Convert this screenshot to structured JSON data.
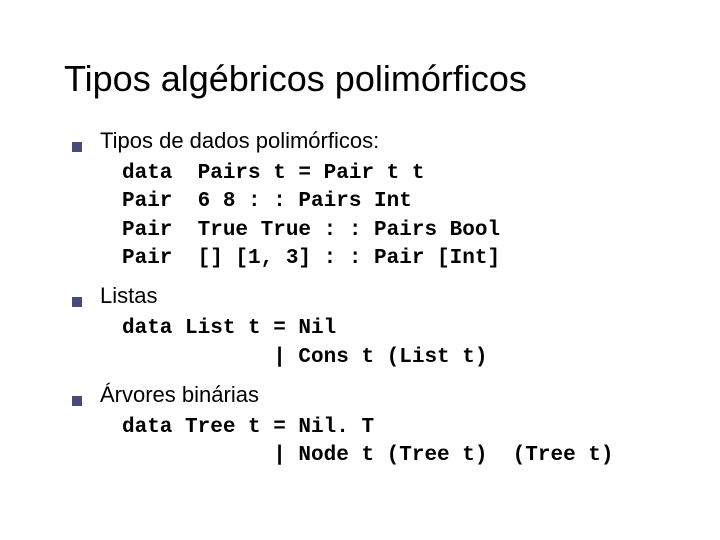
{
  "title": "Tipos algébricos polimórficos",
  "sections": [
    {
      "heading": "Tipos de dados polimórficos:",
      "code": [
        "data  Pairs t = Pair t t",
        "Pair  6 8 : : Pairs Int",
        "Pair  True True : : Pairs Bool",
        "Pair  [] [1, 3] : : Pair [Int]"
      ]
    },
    {
      "heading": "Listas",
      "code": [
        "data List t = Nil",
        "            | Cons t (List t)"
      ]
    },
    {
      "heading": "Árvores binárias",
      "code": [
        "data Tree t = Nil. T",
        "            | Node t (Tree t)  (Tree t)"
      ]
    }
  ]
}
